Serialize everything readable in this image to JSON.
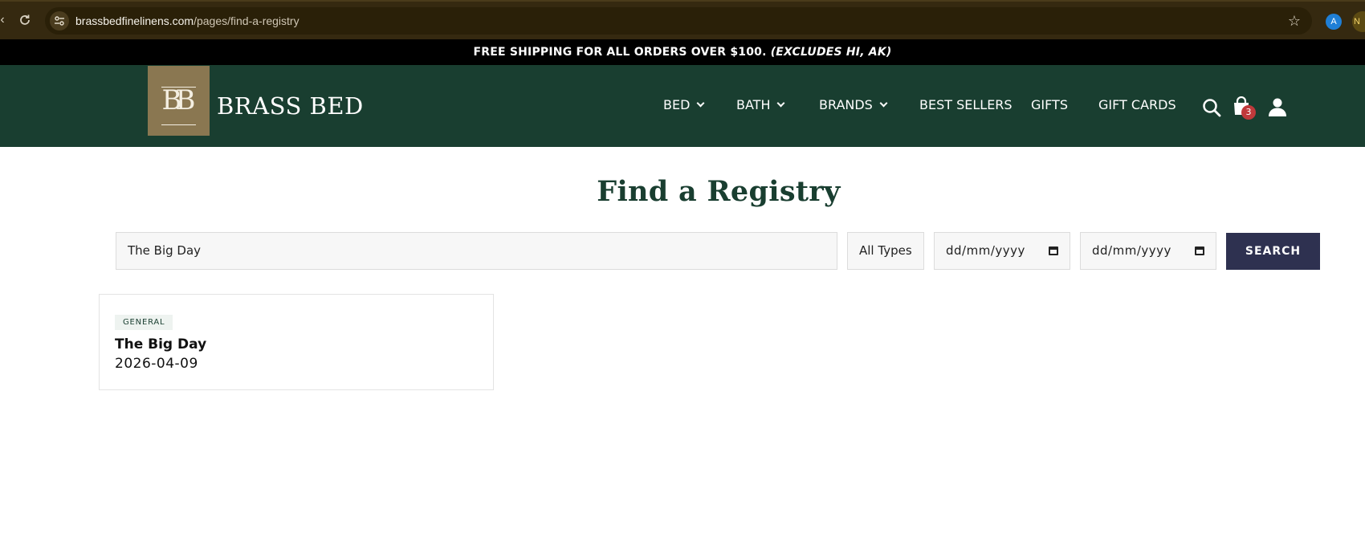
{
  "browser": {
    "url_domain": "brassbedfinelinens.com",
    "url_path": "/pages/find-a-registry",
    "profile_initial": "A",
    "profile_initial_2": "N"
  },
  "announcement": {
    "main": "FREE SHIPPING FOR ALL ORDERS OVER $100. ",
    "note": "(EXCLUDES HI, AK)"
  },
  "header": {
    "logo_monogram": "BB",
    "logo_text": "BRASS BED",
    "nav": [
      {
        "label": "BED",
        "has_dropdown": true
      },
      {
        "label": "BATH",
        "has_dropdown": true
      },
      {
        "label": "BRANDS",
        "has_dropdown": true
      },
      {
        "label": "BEST SELLERS",
        "has_dropdown": false
      },
      {
        "label": "GIFTS",
        "has_dropdown": false
      },
      {
        "label": "GIFT CARDS",
        "has_dropdown": false
      }
    ],
    "cart_count": "3",
    "icons": [
      "search-icon",
      "cart-icon",
      "account-icon"
    ]
  },
  "page": {
    "title": "Find a Registry",
    "search_value": "The Big Day",
    "type_value": "All Types",
    "date_from_placeholder": "dd/mm/yyyy",
    "date_to_placeholder": "dd/mm/yyyy",
    "search_button": "SEARCH"
  },
  "results": [
    {
      "type": "GENERAL",
      "name": "The Big Day",
      "date": "2026-04-09"
    }
  ],
  "colors": {
    "header_bg": "#193e30",
    "logo_bg": "#8a7751",
    "button_bg": "#2e3150",
    "badge_red": "#c0393b"
  }
}
